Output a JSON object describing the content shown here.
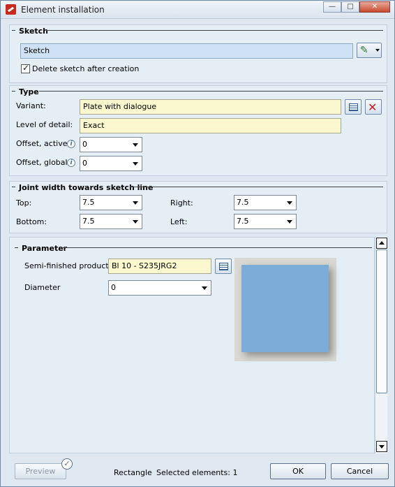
{
  "window": {
    "title": "Element installation",
    "minimize": "—",
    "maximize": "□",
    "close": "✕"
  },
  "sketch": {
    "legend": "Sketch",
    "field_value": "Sketch",
    "delete_label": "Delete sketch after creation",
    "delete_checked": true
  },
  "type": {
    "legend": "Type",
    "variant_label": "Variant:",
    "variant_value": "Plate with dialogue",
    "lod_label": "Level of detail:",
    "lod_value": "Exact",
    "offset_active_label": "Offset, active:",
    "offset_active_value": "0",
    "offset_global_label": "Offset, global:",
    "offset_global_value": "0"
  },
  "joint": {
    "legend": "Joint width towards sketch line",
    "top_label": "Top:",
    "top_value": "7.5",
    "bottom_label": "Bottom:",
    "bottom_value": "7.5",
    "right_label": "Right:",
    "right_value": "7.5",
    "left_label": "Left:",
    "left_value": "7.5"
  },
  "parameter": {
    "legend": "Parameter",
    "semi_label": "Semi-finished product",
    "semi_value": "Bl 10 - S235JRG2",
    "diameter_label": "Diameter",
    "diameter_value": "0",
    "preview_color": "#7eacd8"
  },
  "footer": {
    "preview_label": "Preview",
    "shape": "Rectangle",
    "selected": "Selected elements: 1",
    "ok_label": "OK",
    "cancel_label": "Cancel"
  },
  "icons": {
    "info": "i",
    "delete": "✕",
    "check": "✓"
  }
}
